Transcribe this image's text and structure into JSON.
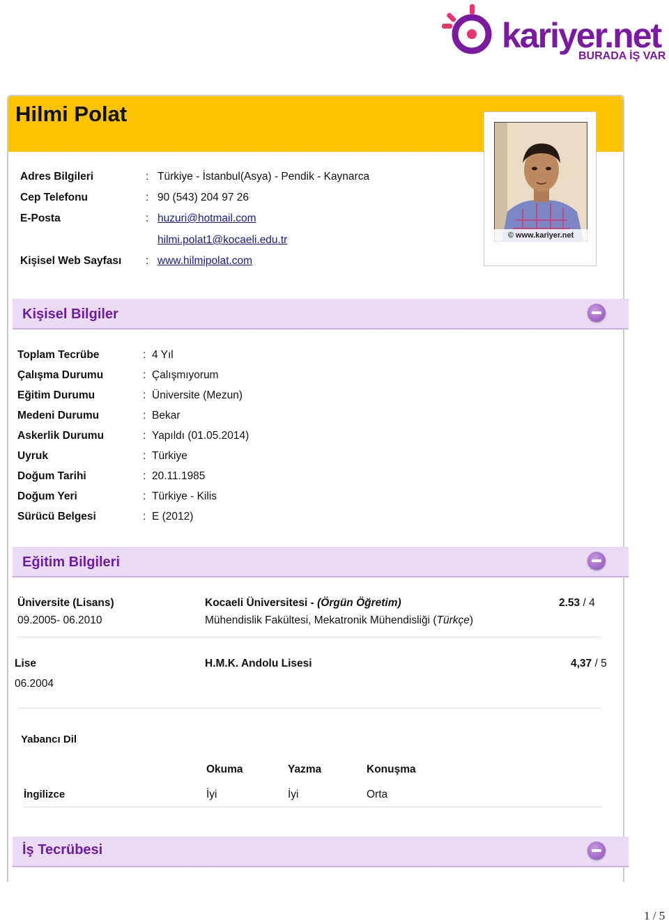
{
  "logo": {
    "word": "kariyer.net",
    "tagline": "BURADA İŞ VAR",
    "accent": "#7a1aa0"
  },
  "header": {
    "name": "Hilmi Polat",
    "band_color": "#fcc400"
  },
  "photo": {
    "watermark": "© www.kariyer.net"
  },
  "contact": {
    "rows": [
      {
        "label": "Adres Bilgileri",
        "value": "Türkiye - İstanbul(Asya) - Pendik - Kaynarca"
      },
      {
        "label": "Cep Telefonu",
        "value": "90 (543) 204 97 26"
      },
      {
        "label": "E-Posta",
        "value": "huzuri@hotmail.com",
        "value2": "hilmi.polat1@kocaeli.edu.tr"
      },
      {
        "label": "Kişisel Web Sayfası",
        "value": "www.hilmipolat.com"
      }
    ]
  },
  "personal": {
    "title": "Kişisel Bilgiler",
    "rows": [
      {
        "label": "Toplam Tecrübe",
        "value": "4 Yıl"
      },
      {
        "label": "Çalışma Durumu",
        "value": "Çalışmıyorum"
      },
      {
        "label": "Eğitim Durumu",
        "value": "Üniversite (Mezun)"
      },
      {
        "label": "Medeni Durumu",
        "value": "Bekar"
      },
      {
        "label": "Askerlik Durumu",
        "value": "Yapıldı (01.05.2014)"
      },
      {
        "label": "Uyruk",
        "value": "Türkiye"
      },
      {
        "label": "Doğum Tarihi",
        "value": "20.11.1985"
      },
      {
        "label": "Doğum Yeri",
        "value": "Türkiye - Kilis"
      },
      {
        "label": "Sürücü Belgesi",
        "value": "E (2012)"
      }
    ]
  },
  "education": {
    "title": "Eğitim Bilgileri",
    "university": {
      "level": "Üniversite (Lisans)",
      "dates": "09.2005- 06.2010",
      "school": "Kocaeli Üniversitesi",
      "school_sep": " - ",
      "type": "(Örgün Öğretim)",
      "dept_prefix": "Mühendislik Fakültesi, Mekatronik Mühendisliği (",
      "dept_lang": "Türkçe",
      "dept_suffix": ")",
      "gpa": "2.53",
      "gpa_scale": " / 4"
    },
    "highschool": {
      "level": "Lise",
      "dates": "06.2004",
      "school": "H.M.K. Andolu Lisesi",
      "gpa": "4,37",
      "gpa_scale": " / 5"
    },
    "languages": {
      "title": "Yabancı Dil",
      "headers": [
        "Okuma",
        "Yazma",
        "Konuşma"
      ],
      "rows": [
        {
          "name": "İngilizce",
          "reading": "İyi",
          "writing": "İyi",
          "speaking": "Orta"
        }
      ]
    }
  },
  "experience": {
    "title": "İş Tecrübesi"
  },
  "page": {
    "number": "1 / 5"
  }
}
